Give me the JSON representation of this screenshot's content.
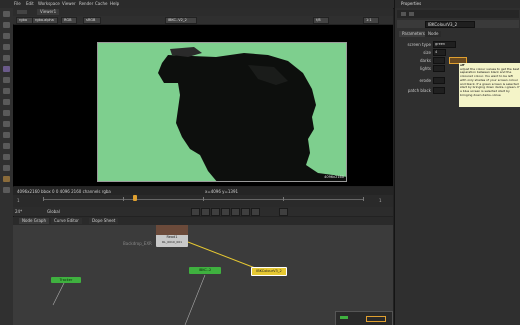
{
  "menubar": {
    "items": [
      "File",
      "Edit",
      "Workspace",
      "Viewer",
      "Render",
      "Cache",
      "Help"
    ]
  },
  "viewer": {
    "tab": "Viewer1",
    "channel": "rgba",
    "alpha": "rgba.alpha",
    "colorspace": "RGB",
    "display": "sRGB",
    "node": "IBKC..V2_2",
    "gain": "f/8",
    "zoom": "1:1",
    "frame_corner_label": "4096x2160",
    "info_text": "4096x2160 bbox 0 0 4096 2160 channels rgba",
    "coord_text": "x=4096 y=1391",
    "timeline_start": "1",
    "timeline_end": "1"
  },
  "transport": {
    "fps": "24*",
    "mode": "Global"
  },
  "nodegraph": {
    "tabs": [
      "Node Graph",
      "Curve Editor",
      "Dope Sheet"
    ],
    "read_node": "Read1",
    "read_sub": "RL_0010_001",
    "backdrop_text": "Backdrop_EXR",
    "ibk_node": "IBKColourV3_2",
    "ibk_sub": "IBKColourV3",
    "green_a": "Tracker",
    "green_b": "IBKC..2",
    "green_c": "Viewer"
  },
  "properties": {
    "title": "Properties",
    "node_name": "IBKColourV3_2",
    "tabs": [
      "Parameters",
      "Node"
    ],
    "fields": {
      "screen_type_label": "screen type",
      "screen_type_value": "green",
      "size_label": "size",
      "size_value": "4",
      "darks_label": "darks",
      "lights_label": "lights",
      "erode_label": "erode",
      "patch_black_label": "patch black"
    },
    "tooltip_title": "off",
    "tooltip": "adjust the colour values to get the best separation between black and the coloured colour. You want to be left with only shades of your screen colour and black. If a green screen is selected start by bringing down darks->green. If a blue screen is selected start by bringing down darks->blue"
  },
  "colors": {
    "accent": "#e0a030",
    "screen": "#7ecf8e",
    "node_green": "#3fb13f",
    "node_yellow": "#e6c832"
  }
}
